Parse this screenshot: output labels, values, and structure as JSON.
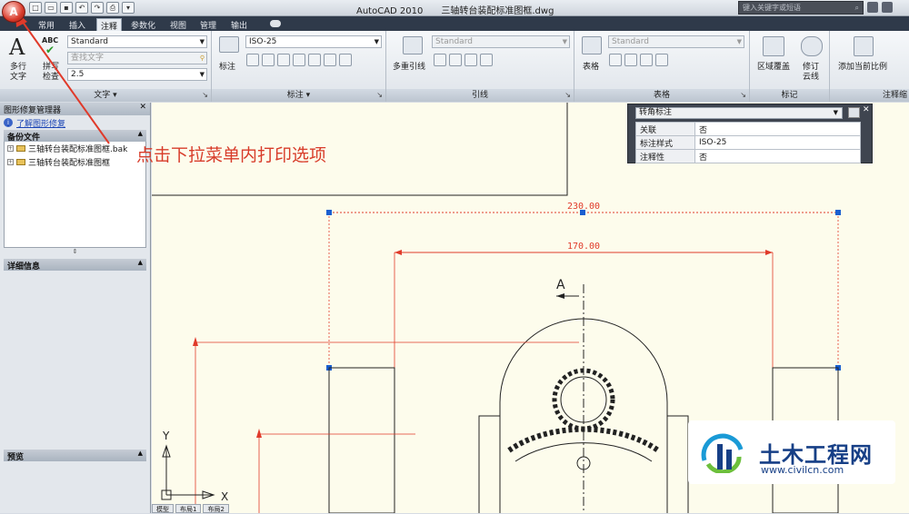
{
  "window": {
    "app_name": "AutoCAD 2010",
    "file_name": "三轴转台装配标准图框.dwg",
    "search_placeholder": "键入关键字或短语"
  },
  "tabs": [
    "常用",
    "插入",
    "注释",
    "参数化",
    "视图",
    "管理",
    "输出"
  ],
  "active_tab": "注释",
  "ribbon": {
    "text_panel": {
      "title": "文字",
      "multiline_label_1": "多行",
      "multiline_label_2": "文字",
      "spell_label_1": "拼写",
      "spell_label_2": "检查",
      "style_value": "Standard",
      "find_placeholder": "查找文字",
      "height_value": "2.5",
      "abc": "ABC"
    },
    "dim_panel": {
      "title": "标注",
      "dim_label": "标注",
      "style_value": "ISO-25"
    },
    "leader_panel": {
      "title": "引线",
      "mleader_label": "多重引线",
      "style_value": "Standard"
    },
    "table_panel": {
      "title": "表格",
      "table_label": "表格",
      "style_value": "Standard"
    },
    "markup_panel": {
      "title": "标记",
      "wipeout_label": "区域覆盖",
      "revcloud_label_1": "修订",
      "revcloud_label_2": "云线"
    },
    "annoscale_panel": {
      "title": "注释缩",
      "add_scale_label": "添加当前比例"
    }
  },
  "drawing_recovery": {
    "title": "图形修复管理器",
    "learn_link": "了解图形修复",
    "backup_section": "备份文件",
    "backup_items": [
      "三轴转台装配标准图框.bak",
      "三轴转台装配标准图框"
    ],
    "details_section": "详细信息",
    "preview_section": "预览"
  },
  "properties": {
    "object_type": "转角标注",
    "rows": [
      {
        "key": "关联",
        "value": "否"
      },
      {
        "key": "标注样式",
        "value": "ISO-25"
      },
      {
        "key": "注释性",
        "value": "否"
      }
    ]
  },
  "drawing": {
    "dim_outer": "230.00",
    "dim_inner": "170.00",
    "section_label": "A",
    "axis_x": "X",
    "axis_y": "Y"
  },
  "layout_tabs": [
    "模型",
    "布局1",
    "布局2"
  ],
  "annotation": {
    "instruction_text": "点击下拉菜单内打印选项",
    "color": "#d83c2a"
  },
  "watermark": {
    "title": "土木工程网",
    "url": "www.civilcn.com"
  }
}
